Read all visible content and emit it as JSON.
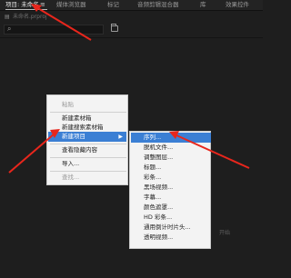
{
  "tabs": [
    {
      "label": "项目: 未命名",
      "active": true
    },
    {
      "label": "媒体浏览器",
      "active": false
    },
    {
      "label": "标记",
      "active": false
    },
    {
      "label": "音频剪辑混合器",
      "active": false
    },
    {
      "label": "库",
      "active": false
    },
    {
      "label": "效果控件",
      "active": false
    }
  ],
  "tab_menu_icon": "≡",
  "subhead_label": "未命名.prproj",
  "search": {
    "icon": "search-icon",
    "value": ""
  },
  "hint": "开始",
  "context_menu": {
    "items": [
      {
        "label": "粘贴",
        "disabled": true
      },
      {
        "label": "新建素材箱",
        "disabled": false
      },
      {
        "label": "新建搜索素材箱",
        "disabled": false
      },
      {
        "label": "新建项目",
        "disabled": false,
        "highlighted": true,
        "has_submenu": true
      },
      {
        "label": "查看隐藏内容",
        "disabled": false
      },
      {
        "label": "导入...",
        "disabled": false
      },
      {
        "label": "查找...",
        "disabled": true
      }
    ],
    "submenu_arrow": "▶"
  },
  "submenu": {
    "items": [
      {
        "label": "序列...",
        "highlighted": true
      },
      {
        "label": "脱机文件..."
      },
      {
        "label": "调整图层..."
      },
      {
        "label": "标题..."
      },
      {
        "label": "彩条..."
      },
      {
        "label": "黑场视频..."
      },
      {
        "label": "字幕..."
      },
      {
        "label": "颜色遮罩..."
      },
      {
        "label": "HD 彩条..."
      },
      {
        "label": "通用倒计时片头..."
      },
      {
        "label": "透明视频..."
      }
    ]
  },
  "colors": {
    "panel_bg": "#1e1e1e",
    "menu_bg": "#f3f3f3",
    "highlight": "#3b7fd4",
    "annotation_arrow": "#e8261c"
  }
}
